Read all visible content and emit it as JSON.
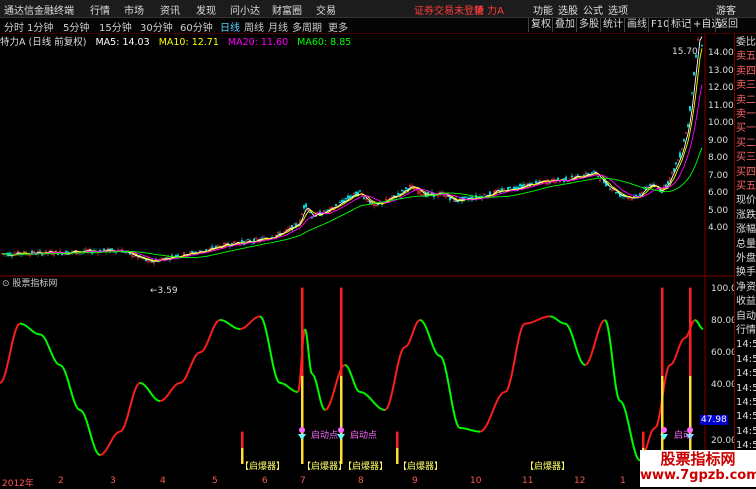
{
  "titlebar": {
    "app_name": "通达信金融终端",
    "menu": [
      "行情",
      "市场",
      "资讯",
      "发现",
      "问小达",
      "财富圈",
      "交易"
    ],
    "notice": "证券交易未登录",
    "stock": "特 力A",
    "right_menu": [
      "功能",
      "选股",
      "公式",
      "选项",
      "游客"
    ]
  },
  "toolbar": {
    "periods": [
      "分时",
      "1分钟",
      "5分钟",
      "15分钟",
      "30分钟",
      "60分钟",
      "日线",
      "周线",
      "月线",
      "多周期",
      "更多"
    ],
    "active_period": "日线",
    "buttons": [
      "复权",
      "叠加",
      "多股",
      "统计",
      "画线",
      "F10",
      "标记",
      "+自选",
      "返回"
    ]
  },
  "info": {
    "stock_label": "特力A (日线 前复权)",
    "ma5": "MA5: 14.03",
    "ma10": "MA10: 12.71",
    "ma20": "MA20: 11.60",
    "ma60": "MA60: 8.85"
  },
  "price_axis": [
    "14.00",
    "13.00",
    "12.00",
    "11.00",
    "10.00",
    "9.00",
    "8.00",
    "7.00",
    "6.00",
    "5.00",
    "4.00"
  ],
  "annotations": {
    "high": "15.70",
    "low": "3.59"
  },
  "indicator": {
    "header": "股票指标网",
    "axis": [
      "100.0",
      "80.00",
      "60.00",
      "40.00",
      "20.00"
    ],
    "current": "47.98",
    "labels": [
      "启爆器",
      "启爆器",
      "启爆器",
      "启爆器",
      "启爆器",
      "启动点",
      "启动点",
      "启动"
    ]
  },
  "side_panel": [
    "委比",
    "卖五",
    "卖四",
    "卖三",
    "卖二",
    "卖一",
    "买一",
    "买二",
    "买三",
    "买四",
    "买五",
    "现价",
    "涨跌",
    "涨幅",
    "总量",
    "外盘",
    "换手",
    "净资",
    "收益",
    "自动",
    "行情",
    "14:5",
    "14:5",
    "14:5",
    "14:5",
    "14:5",
    "14:5",
    "14:5",
    "14:5",
    "14:5",
    "14:5"
  ],
  "date_axis": [
    "2012年",
    "2",
    "3",
    "4",
    "5",
    "6",
    "7",
    "8",
    "9",
    "10",
    "11",
    "12",
    "1",
    "2"
  ],
  "watermark": {
    "line1": "股票指标网",
    "line2": "www.7gpzb.com"
  },
  "colors": {
    "up": "#ff3232",
    "down": "#00ff00",
    "ma5": "#ffffff",
    "ma10": "#ffff00",
    "ma20": "#ff00ff",
    "ma60": "#00ff00"
  }
}
